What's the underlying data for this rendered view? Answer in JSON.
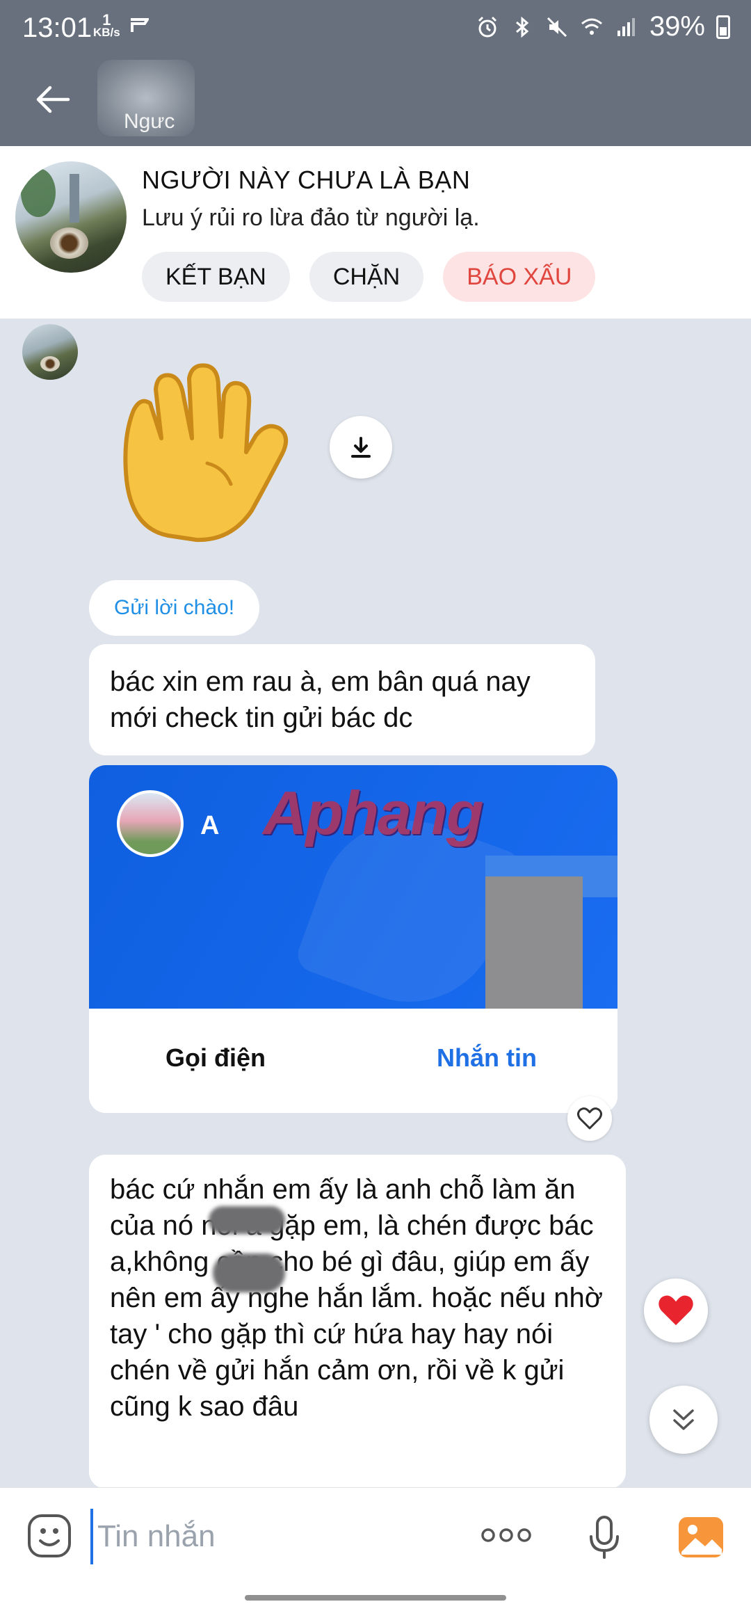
{
  "status_bar": {
    "time": "13:01",
    "net_speed_value": "1",
    "net_speed_unit": "KB/s",
    "battery": "39%"
  },
  "header": {
    "contact_name_partial": "Ngưc",
    "icons": [
      "back-arrow-icon",
      "phone-icon",
      "video-call-icon",
      "menu-list-icon"
    ]
  },
  "stranger_banner": {
    "title": "NGƯỜI NÀY CHƯA LÀ BẠN",
    "subtitle": "Lưu ý rủi ro lừa đảo từ người lạ.",
    "buttons": {
      "add_friend": "KẾT BẠN",
      "block": "CHẶN",
      "report": "BÁO XẤU"
    }
  },
  "chat": {
    "greeting_button": "Gửi lời chào!",
    "messages": [
      {
        "text": "bác xin em rau à, em bân quá nay mới check tin gửi bác dc"
      },
      {
        "contact_card": {
          "name_partial": "A",
          "watermark": "Aphang",
          "action_call": "Gọi điện",
          "action_message": "Nhắn tin"
        }
      },
      {
        "text": "bác cứ nhắn em ấy là anh chỗ làm ăn của      nó nói a gặp em, là chén được bác a,không cần cho bé gì đâu,      giúp em ấy nên em ấy nghe hắn lắm. hoặc nếu nhờ tay ' cho gặp thì cứ hứa hay hay nói chén về gửi hắn cảm ơn, rồi về k gửi cũng k sao đâu"
      }
    ],
    "reaction": "heart",
    "accent_color": "#1f8fe5",
    "card_color": "#1565e6"
  },
  "input_bar": {
    "placeholder": "Tin nhắn"
  }
}
